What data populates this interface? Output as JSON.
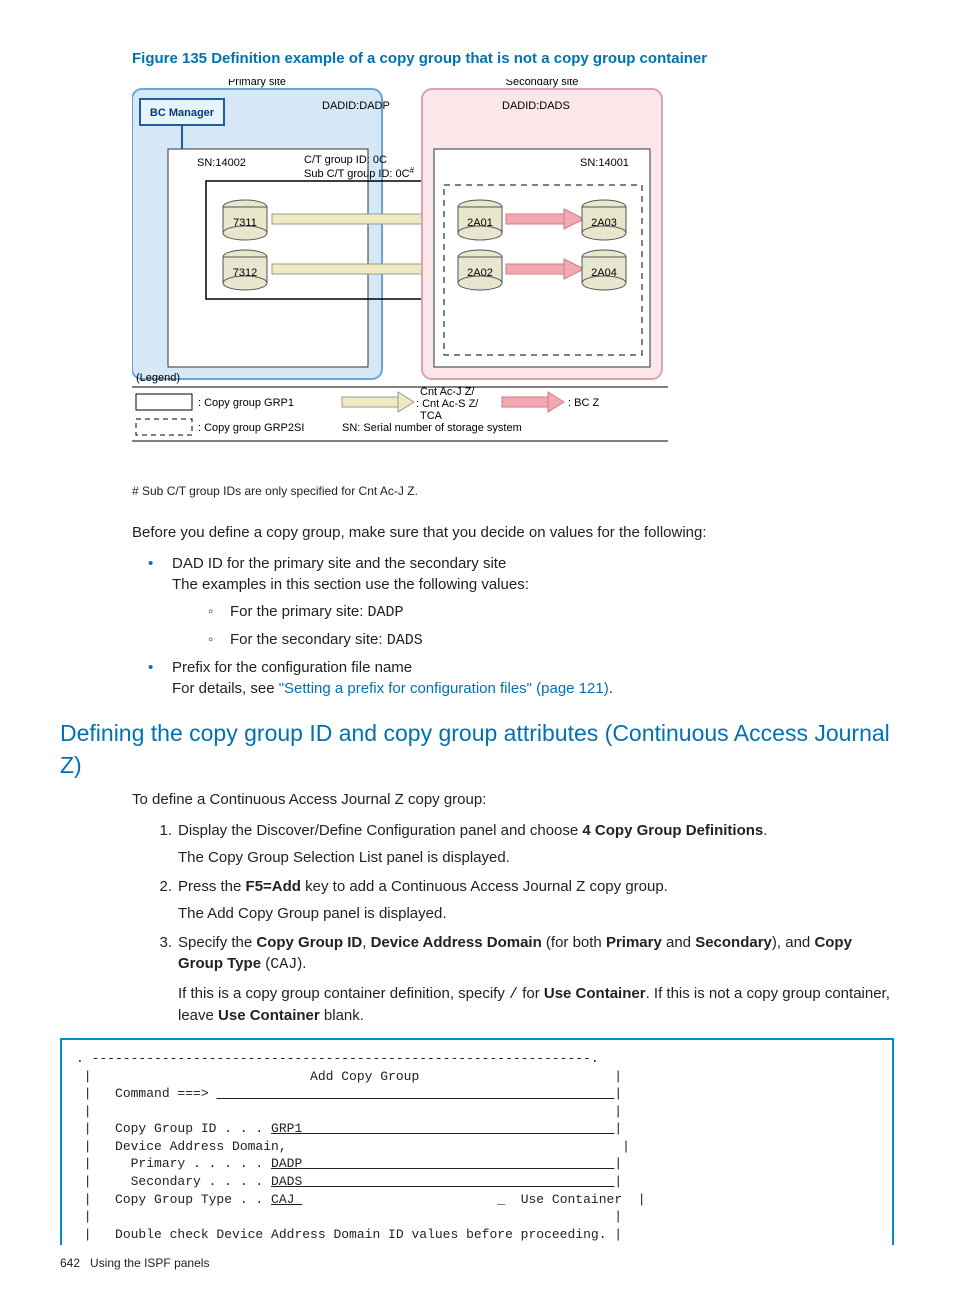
{
  "figure": {
    "title": "Figure 135 Definition example of a copy group that is not a copy group container",
    "primary_site": "Primary site",
    "secondary_site": "Secondary site",
    "dadid_primary": "DADID:DADP",
    "dadid_secondary": "DADID:DADS",
    "bc_manager": "BC Manager",
    "sn_primary": "SN:14002",
    "sn_secondary": "SN:14001",
    "ct_group_id": "C/T group ID: 0C",
    "sub_ct_group_id": "Sub C/T group ID: 0C",
    "dash_sup": "#",
    "vol_p1": "7311",
    "vol_p2": "7312",
    "vol_s1": "2A01",
    "vol_s2": "2A02",
    "vol_s3": "2A03",
    "vol_s4": "2A04",
    "legend": "(Legend)",
    "legend_grp1": ": Copy group GRP1",
    "legend_grp2si": ": Copy group GRP2SI",
    "legend_cnt": "Cnt Ac-J Z/",
    "legend_cnt2": ": Cnt Ac-S Z/",
    "legend_tca": "TCA",
    "legend_bcz": ": BC Z",
    "legend_sn": "SN: Serial number of storage system"
  },
  "footnote": "# Sub C/T group IDs are only specified for Cnt Ac-J Z.",
  "intro": "Before you define a copy group, make sure that you decide on values for the following:",
  "b1": {
    "line1": "DAD ID for the primary site and the secondary site",
    "line2": "The examples in this section use the following values:",
    "sub1_pre": "For the primary site: ",
    "sub1_code": "DADP",
    "sub2_pre": "For the secondary site: ",
    "sub2_code": "DADS"
  },
  "b2": {
    "line1": "Prefix for the configuration file name",
    "line2a": "For details, see ",
    "link": "\"Setting a prefix for configuration files\" (page 121)",
    "line2b": "."
  },
  "section_title": "Defining the copy group ID and copy group attributes (Continuous Access Journal Z)",
  "sect_intro": "To define a Continuous Access Journal Z copy group:",
  "s1": {
    "a1": "Display the Discover/Define Configuration panel and choose ",
    "b1": "4 Copy Group Definitions",
    "a2": ".",
    "line2": "The Copy Group Selection List panel is displayed."
  },
  "s2": {
    "a1": "Press the ",
    "b1": "F5=Add",
    "a2": " key to add a Continuous Access Journal Z copy group.",
    "line2": "The Add Copy Group panel is displayed."
  },
  "s3": {
    "a1": "Specify the ",
    "b1": "Copy Group ID",
    "a2": ", ",
    "b2": "Device Address Domain",
    "a3": " (for both ",
    "b3": "Primary",
    "a4": " and ",
    "b4": "Secondary",
    "a5": "), and ",
    "b5": "Copy Group Type",
    "a6": " (",
    "code": "CAJ",
    "a7": ").",
    "p2a": "If this is a copy group container definition, specify ",
    "p2code": "/",
    "p2b": " for ",
    "p2bold1": "Use Container",
    "p2c": ". If this is not a copy group container, leave ",
    "p2bold2": "Use Container",
    "p2d": " blank."
  },
  "terminal": {
    "border": ". ----------------------------------------------------------------.",
    "title": "                            Add Copy Group                         ",
    "cmd": "   Command ===> ",
    "blank": "                                                                   ",
    "cg": "   Copy Group ID . . . ",
    "cg_val": "GRP1",
    "dad": "   Device Address Domain,                                           ",
    "pri": "     Primary . . . . . ",
    "pri_val": "DADP",
    "sec": "     Secondary . . . . ",
    "sec_val": "DADS",
    "type": "   Copy Group Type . . ",
    "type_val": "CAJ ",
    "use_cont": "                         _  Use Container  ",
    "warn": "   Double check Device Address Domain ID values before proceeding. "
  },
  "footer": {
    "page": "642",
    "label": "Using the ISPF panels"
  }
}
